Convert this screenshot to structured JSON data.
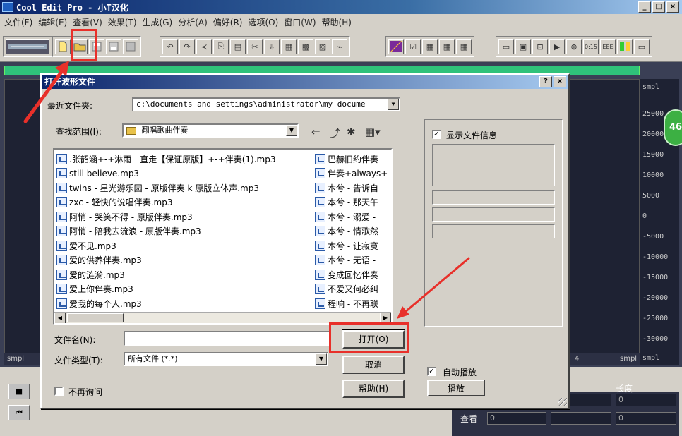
{
  "app": {
    "title": "Cool Edit Pro  - 小T汉化",
    "window_buttons": [
      "_",
      "□",
      "×"
    ]
  },
  "menubar": [
    "文件(F)",
    "编辑(E)",
    "查看(V)",
    "效果(T)",
    "生成(G)",
    "分析(A)",
    "偏好(R)",
    "选项(O)",
    "窗口(W)",
    "帮助(H)"
  ],
  "ruler": {
    "unit_top": "smpl",
    "ticks": [
      "25000",
      "20000",
      "15000",
      "10000",
      "5000",
      "0",
      "-5000",
      "-10000",
      "-15000",
      "-20000",
      "-25000",
      "-30000"
    ],
    "unit_bottom": "smpl",
    "badge": "46"
  },
  "timeline": {
    "left_label": "smpl",
    "tick": "4",
    "right_label": "smpl"
  },
  "bottom_panel": {
    "length_label": "长度",
    "view_label": "查看",
    "length_values": [
      "0",
      "0",
      "0"
    ],
    "view_value": "0"
  },
  "dialog": {
    "title": "打开波形文件",
    "help_btn": "?",
    "close_btn": "×",
    "recent_label": "最近文件夹:",
    "recent_value": "c:\\documents and settings\\administrator\\my docume",
    "lookin_label": "查找范围(I):",
    "lookin_value": "翻唱歌曲伴奏",
    "files_left": [
      ".张韶涵+-+淋雨一直走【保证原版】+-+伴奏(1).mp3",
      "still believe.mp3",
      "twins - 星光游乐园 - 原版伴奏 k 原版立体声.mp3",
      "zxc - 轻快的说唱伴奏.mp3",
      "阿悄 - 哭笑不得 - 原版伴奏.mp3",
      "阿悄 - 陪我去流浪 - 原版伴奏.mp3",
      "爱不见.mp3",
      "爱的供养伴奏.mp3",
      "爱的涟漪.mp3",
      "爱上你伴奏.mp3",
      "爱我的每个人.mp3"
    ],
    "files_right": [
      "巴赫旧约伴奏",
      "伴奏+always+",
      "本兮 - 告诉自",
      "本兮 - 那天午",
      "本兮 - 溺爱 -",
      "本兮 - 情歌然",
      "本兮 - 让寂寞",
      "本兮 - 无语 -",
      "变成回忆伴奏",
      "不爱又何必纠",
      "程响 - 不再联"
    ],
    "filename_label": "文件名(N):",
    "filename_value": "",
    "filetype_label": "文件类型(T):",
    "filetype_value": "所有文件  (*.*)",
    "open_btn": "打开(O)",
    "cancel_btn": "取消",
    "help_btn_label": "帮助(H)",
    "no_ask_label": "不再询问",
    "show_info_label": "显示文件信息",
    "autoplay_label": "自动播放",
    "play_btn": "播放"
  },
  "colors": {
    "highlight": "#e8302a",
    "dialog_bg": "#d4d0c8",
    "title_gradient_start": "#0a246a"
  }
}
